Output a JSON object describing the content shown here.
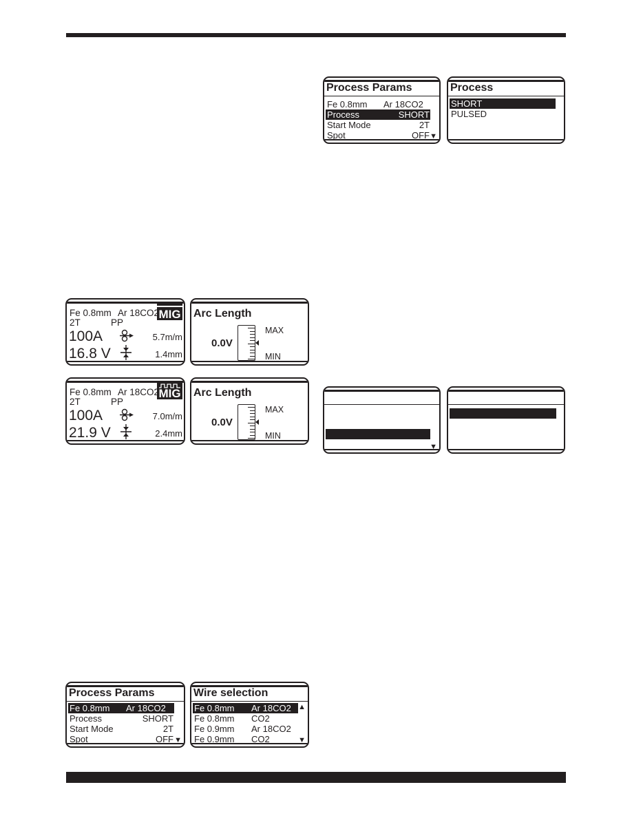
{
  "process_params_a": {
    "title": "Process Params",
    "rows": [
      {
        "label": "Fe 0.8mm",
        "value": "Ar 18CO2",
        "selected": false
      },
      {
        "label": "Process",
        "value": "SHORT",
        "selected": true
      },
      {
        "label": "Start Mode",
        "value": "2T",
        "selected": false
      },
      {
        "label": "Spot",
        "value": "OFF",
        "selected": false
      }
    ],
    "scroll_down": "▼"
  },
  "process_menu": {
    "title": "Process",
    "options": [
      {
        "label": "SHORT",
        "selected": true
      },
      {
        "label": "PULSED",
        "selected": false
      }
    ]
  },
  "main_short": {
    "wire": "Fe 0.8mm",
    "gas": "Ar 18CO2",
    "mode_icon": "MIG",
    "start_mode": "2T",
    "profile": "PP",
    "current": "100A",
    "voltage": "16.8 V",
    "wire_speed": "5.7m/m",
    "thickness": "1.4mm"
  },
  "arc_length_a": {
    "title": "Arc Length",
    "value": "0.0V",
    "max_label": "MAX",
    "min_label": "MIN",
    "level": 0.5
  },
  "main_pulsed": {
    "wire": "Fe 0.8mm",
    "gas": "Ar 18CO2",
    "mode_icon": "MIG",
    "start_mode": "2T",
    "profile": "PP",
    "current": "100A",
    "voltage": "21.9 V",
    "wire_speed": "7.0m/m",
    "thickness": "2.4mm"
  },
  "arc_length_b": {
    "title": "Arc Length",
    "value": "0.0V",
    "max_label": "MAX",
    "min_label": "MIN",
    "level": 0.5
  },
  "blank_params": {
    "scroll_down": "▼"
  },
  "process_params_b": {
    "title": "Process Params",
    "rows": [
      {
        "label": "Fe 0.8mm",
        "value": "Ar 18CO2",
        "selected": true
      },
      {
        "label": "Process",
        "value": "SHORT",
        "selected": false
      },
      {
        "label": "Start Mode",
        "value": "2T",
        "selected": false
      },
      {
        "label": "Spot",
        "value": "OFF",
        "selected": false
      }
    ],
    "scroll_down": "▼"
  },
  "wire_selection": {
    "title": "Wire selection",
    "rows": [
      {
        "wire": "Fe 0.8mm",
        "gas": "Ar 18CO2",
        "selected": true
      },
      {
        "wire": "Fe 0.8mm",
        "gas": "CO2",
        "selected": false
      },
      {
        "wire": "Fe 0.9mm",
        "gas": "Ar 18CO2",
        "selected": false
      },
      {
        "wire": "Fe 0.9mm",
        "gas": "CO2",
        "selected": false
      }
    ],
    "scroll_up": "▲",
    "scroll_down": "▼"
  }
}
